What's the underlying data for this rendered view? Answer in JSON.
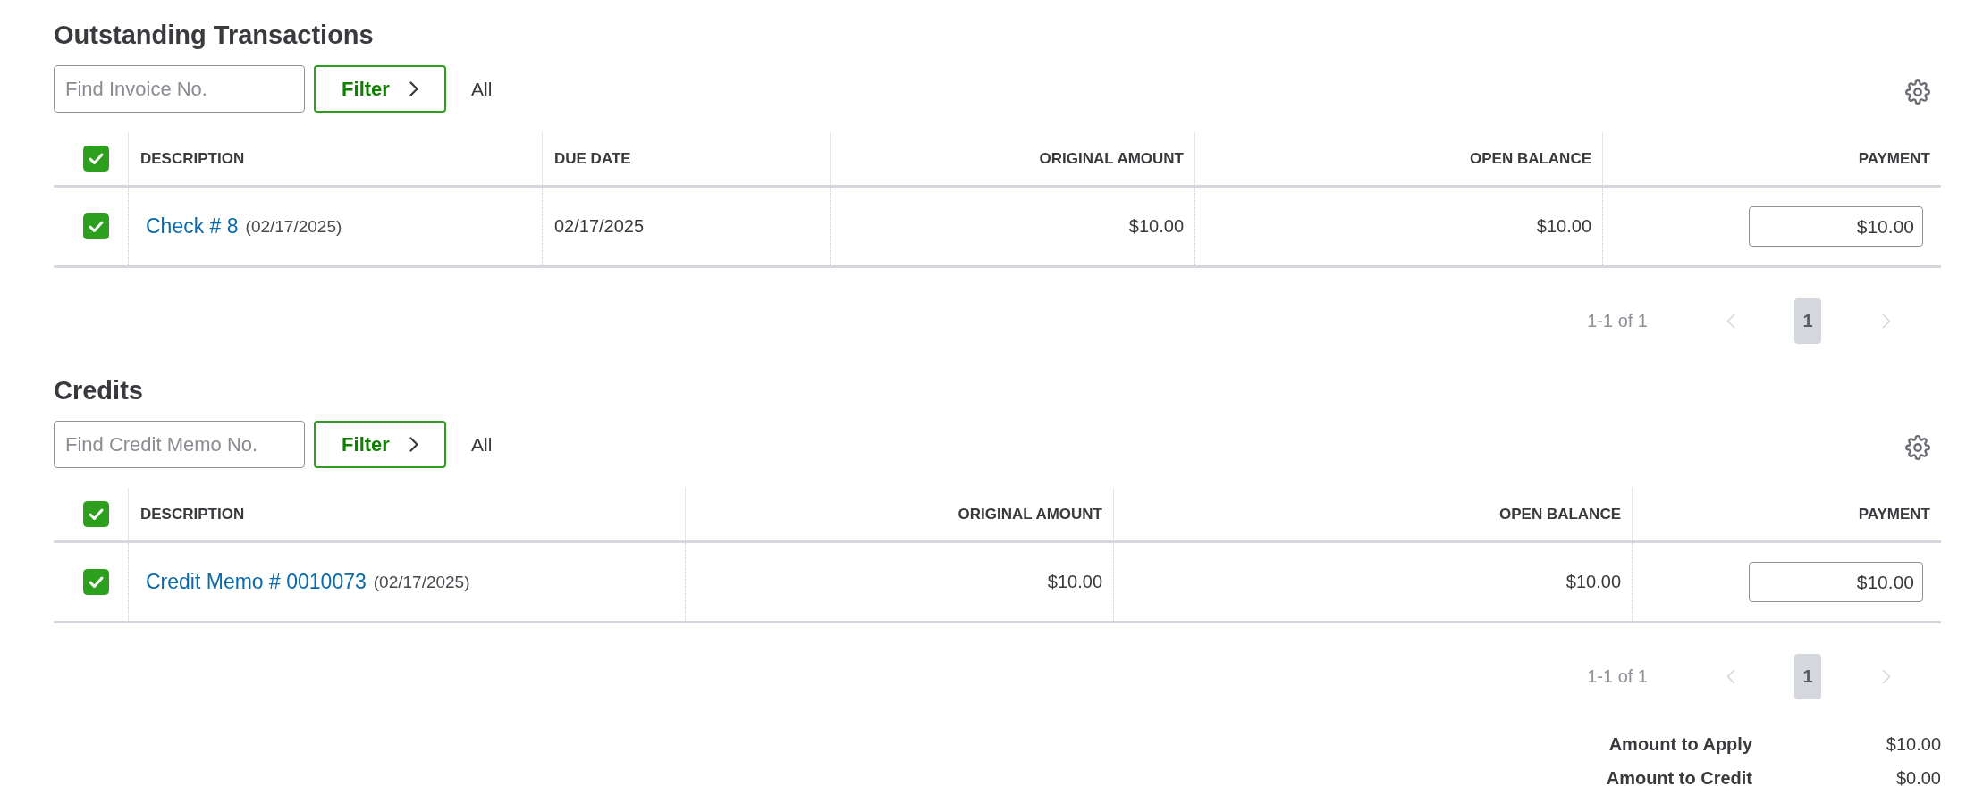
{
  "sections": [
    {
      "title": "Outstanding Transactions",
      "search": {
        "placeholder": "Find Invoice No."
      },
      "filter": {
        "label": "Filter",
        "value": "All"
      },
      "table": {
        "header_checkbox": {
          "checked": true
        },
        "columns": [
          {
            "label": "DESCRIPTION",
            "kind": "description"
          },
          {
            "label": "DUE DATE",
            "kind": "date"
          },
          {
            "label": "ORIGINAL AMOUNT",
            "kind": "amount"
          },
          {
            "label": "OPEN BALANCE",
            "kind": "amount"
          },
          {
            "label": "PAYMENT",
            "kind": "payment"
          }
        ],
        "rows": [
          {
            "checked": true,
            "cells": [
              {
                "link": "Check # 8",
                "note": "(02/17/2025)"
              },
              {
                "text": "02/17/2025"
              },
              {
                "text": "$10.00"
              },
              {
                "text": "$10.00"
              },
              {
                "value": "$10.00"
              }
            ]
          }
        ]
      },
      "pagination": {
        "range": "1-1 of 1",
        "prev": {
          "disabled": true
        },
        "pages": [
          {
            "label": "1",
            "selected": true
          }
        ],
        "next": {
          "disabled": true
        }
      }
    },
    {
      "title": "Credits",
      "search": {
        "placeholder": "Find Credit Memo No."
      },
      "filter": {
        "label": "Filter",
        "value": "All"
      },
      "table": {
        "header_checkbox": {
          "checked": true
        },
        "columns": [
          {
            "label": "DESCRIPTION",
            "kind": "description"
          },
          {
            "label": "ORIGINAL AMOUNT",
            "kind": "amount"
          },
          {
            "label": "OPEN BALANCE",
            "kind": "amount"
          },
          {
            "label": "PAYMENT",
            "kind": "payment"
          }
        ],
        "rows": [
          {
            "checked": true,
            "cells": [
              {
                "link": "Credit Memo # 0010073",
                "note": "(02/17/2025)"
              },
              {
                "text": "$10.00"
              },
              {
                "text": "$10.00"
              },
              {
                "value": "$10.00"
              }
            ]
          }
        ]
      },
      "pagination": {
        "range": "1-1 of 1",
        "prev": {
          "disabled": true
        },
        "pages": [
          {
            "label": "1",
            "selected": true
          }
        ],
        "next": {
          "disabled": true
        }
      }
    }
  ],
  "totals": [
    {
      "label": "Amount to Apply",
      "value": "$10.00"
    },
    {
      "label": "Amount to Credit",
      "value": "$0.00"
    }
  ]
}
